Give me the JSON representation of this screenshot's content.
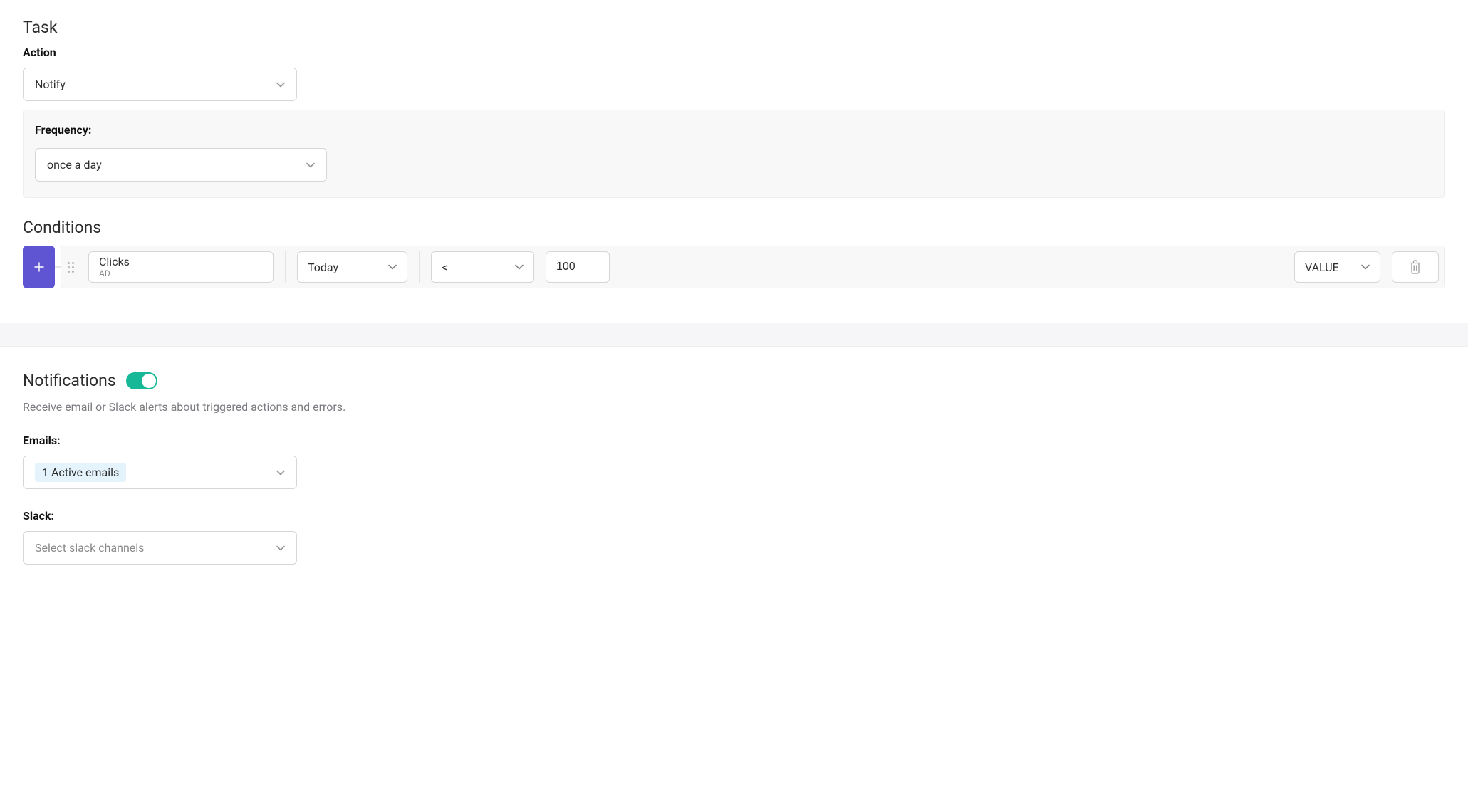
{
  "task": {
    "title": "Task",
    "action_label": "Action",
    "action_value": "Notify",
    "frequency_label": "Frequency:",
    "frequency_value": "once a day"
  },
  "conditions": {
    "title": "Conditions",
    "row": {
      "metric": "Clicks",
      "metric_sub": "AD",
      "timeframe": "Today",
      "operator": "<",
      "value": "100",
      "type": "VALUE"
    }
  },
  "notifications": {
    "title": "Notifications",
    "helper": "Receive email or Slack alerts about triggered actions and errors.",
    "emails_label": "Emails:",
    "emails_tag": "1 Active emails",
    "slack_label": "Slack:",
    "slack_placeholder": "Select slack channels"
  }
}
